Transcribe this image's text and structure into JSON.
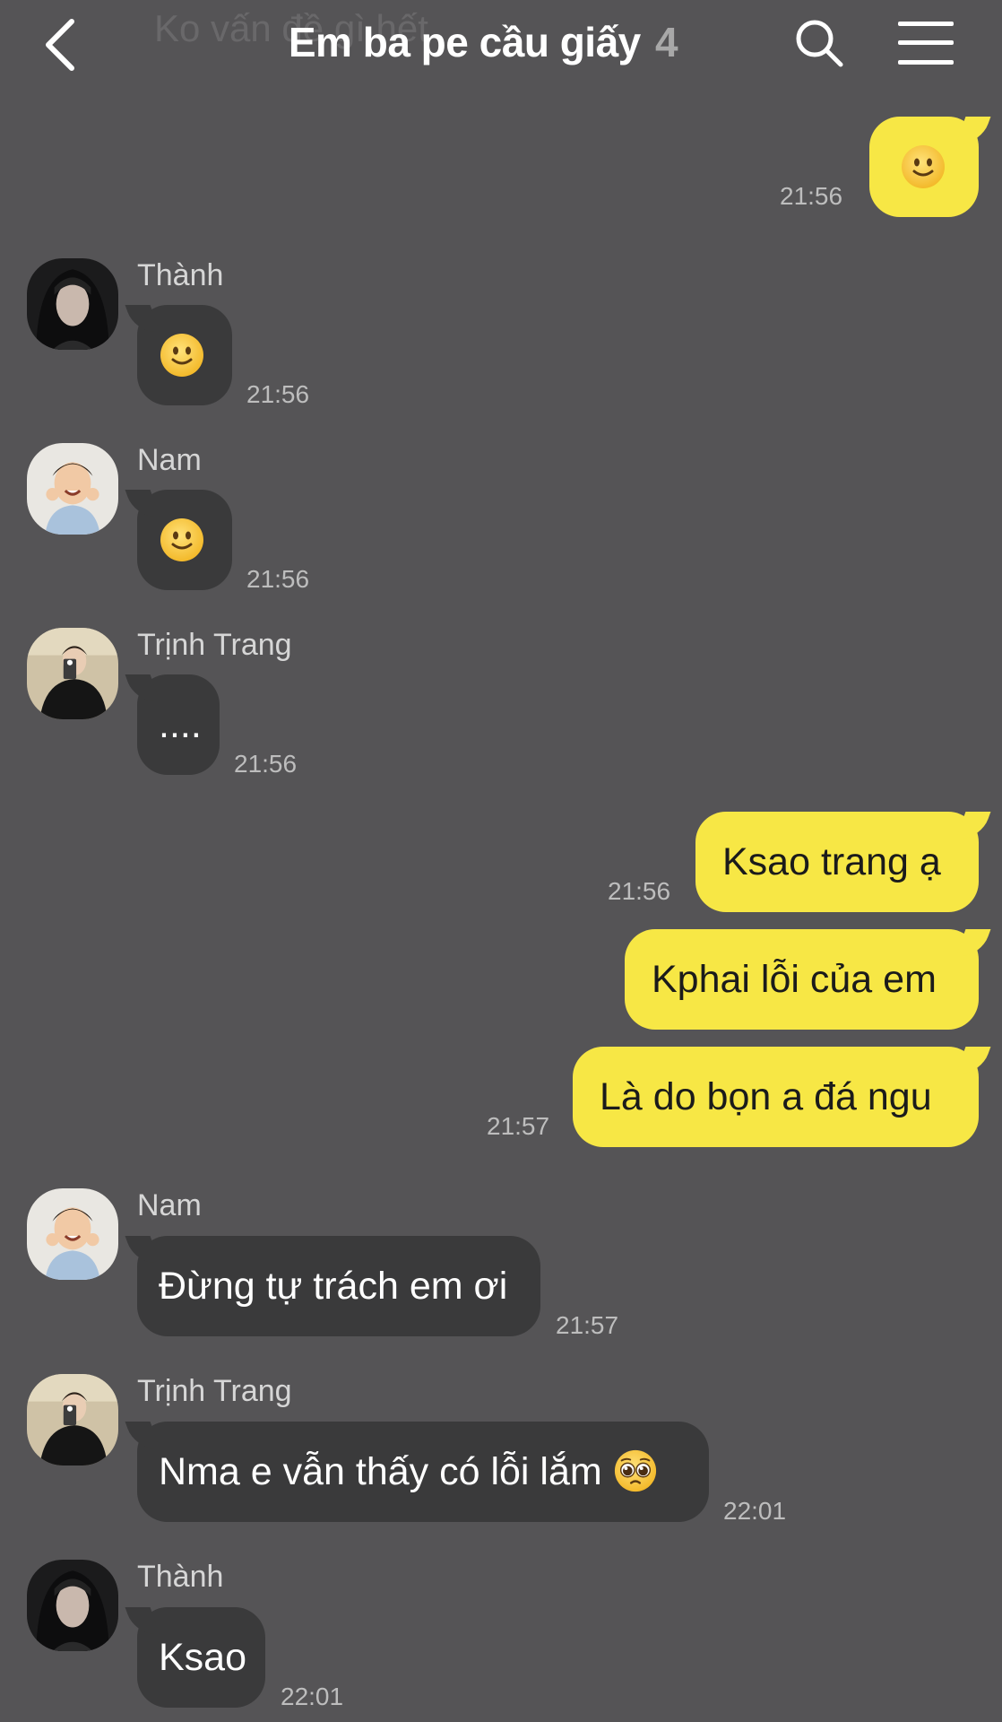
{
  "header": {
    "ghost_text": "Ko vấn đề gì hết",
    "title": "Em ba pe cầu giấy",
    "member_count": "4",
    "icons": {
      "back": "chevron-left-icon",
      "search": "search-icon",
      "menu": "hamburger-menu-icon"
    }
  },
  "colors": {
    "background": "#555456",
    "incoming_bubble": "#3a3a3b",
    "outgoing_bubble": "#f7e745"
  },
  "messages": [
    {
      "sender": "",
      "direction": "out",
      "text": "",
      "emoji": "slightly-smiling-face",
      "time": "21:56"
    },
    {
      "sender": "Thành",
      "direction": "in",
      "text": "",
      "emoji": "slightly-smiling-face",
      "time": "21:56"
    },
    {
      "sender": "Nam",
      "direction": "in",
      "text": "",
      "emoji": "slightly-smiling-face",
      "time": "21:56"
    },
    {
      "sender": "Trịnh Trang",
      "direction": "in",
      "text": "....",
      "time": "21:56"
    },
    {
      "sender": "",
      "direction": "out",
      "text": "Ksao trang ạ",
      "time": "21:56"
    },
    {
      "sender": "",
      "direction": "out",
      "text": "Kphai lỗi của em",
      "time": ""
    },
    {
      "sender": "",
      "direction": "out",
      "text": "Là do bọn a đá ngu",
      "time": "21:57"
    },
    {
      "sender": "Nam",
      "direction": "in",
      "text": "Đừng tự trách em ơi",
      "time": "21:57"
    },
    {
      "sender": "Trịnh Trang",
      "direction": "in",
      "text": "Nma e vẫn thấy có lỗi lắm",
      "emoji": "pleading-face",
      "time": "22:01"
    },
    {
      "sender": "Thành",
      "direction": "in",
      "text": "Ksao",
      "time": "22:01"
    }
  ]
}
